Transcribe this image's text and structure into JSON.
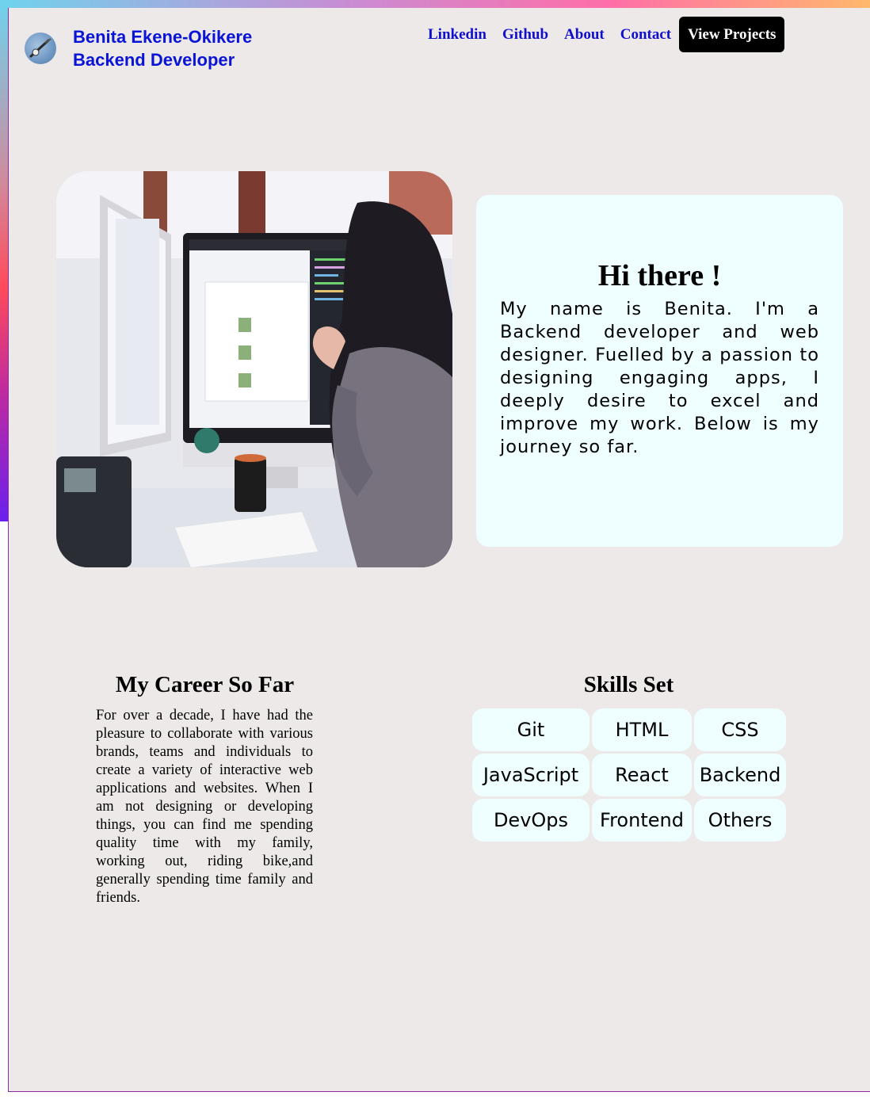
{
  "header": {
    "name": "Benita Ekene-Okikere",
    "role": "Backend Developer",
    "nav": [
      "Linkedin",
      "Github",
      "About",
      "Contact"
    ],
    "cta": "View Projects"
  },
  "intro": {
    "heading": "Hi there !",
    "body": "My name is Benita. I'm a Backend developer and web designer. Fuelled by a passion to designing engaging apps, I deeply desire to excel and improve my work. Below is my journey so far."
  },
  "career": {
    "title": "My Career So Far",
    "body": "For over a decade, I have had the pleasure to collaborate with various brands, teams and individuals to create a variety of interactive web applications and websites. When I am not designing or developing things, you can find me spending quality time with my family, working out, riding bike,and generally spending time family and friends."
  },
  "skills": {
    "title": "Skills Set",
    "items": [
      "Git",
      "HTML",
      "CSS",
      "JavaScript",
      "React",
      "Backend",
      "DevOps",
      "Frontend",
      "Others"
    ]
  },
  "colors": {
    "page_bg": "#ede9e9",
    "card_bg": "#efffff",
    "brand_blue": "#0a14d6",
    "nav_blue": "#1010cc",
    "cta_bg": "#000000",
    "frame_border": "#8e2aa8"
  },
  "icons": {
    "avatar": "profile-photo-avatar",
    "hero": "woman-at-computer-photo"
  }
}
